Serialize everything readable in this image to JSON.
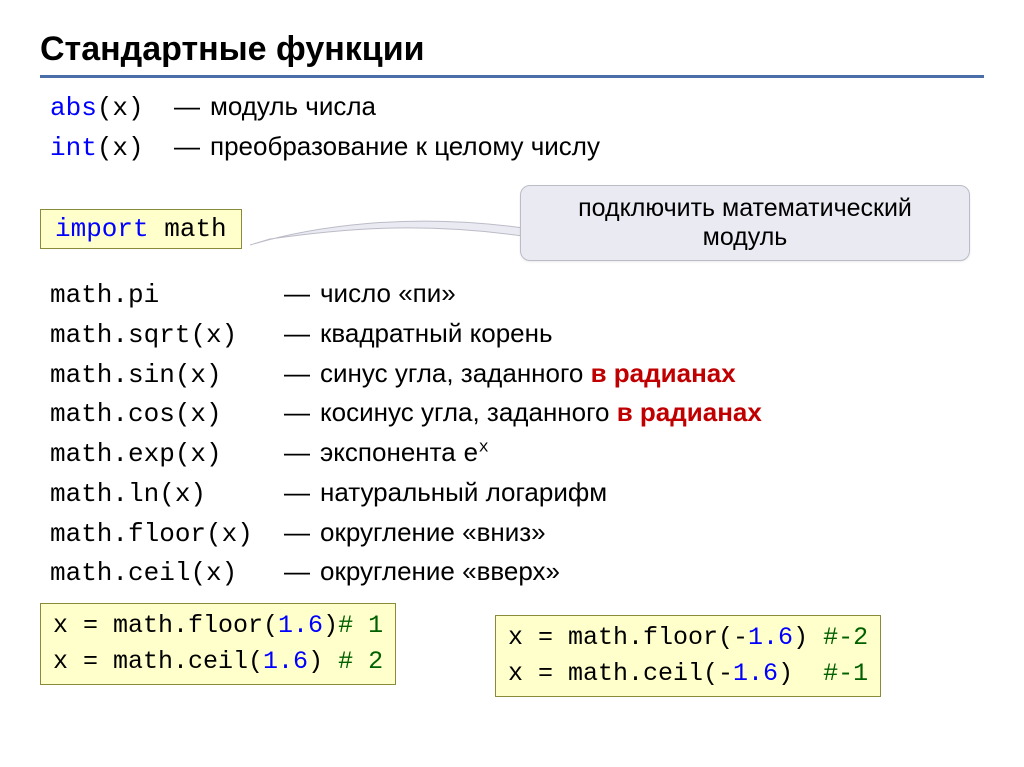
{
  "title": "Стандартные функции",
  "basic": {
    "abs_fn": "abs",
    "abs_args": "(x)",
    "abs_desc": "модуль числа",
    "int_fn": "int",
    "int_args": "(x)",
    "int_desc": "преобразование к целому числу"
  },
  "import_box": {
    "kw": "import",
    "mod": "math"
  },
  "callout": "подключить математический модуль",
  "math": {
    "pi_code": "math.pi",
    "pi_desc": "число «пи»",
    "sqrt_code": "math.sqrt",
    "sqrt_args": "(x)",
    "sqrt_desc": "квадратный корень",
    "sin_code": "math.sin",
    "sin_args": "(x)",
    "sin_desc": "синус угла, заданного ",
    "sin_red": "в радианах",
    "cos_code": "math.cos",
    "cos_args": "(x)",
    "cos_desc": "косинус угла, заданного ",
    "cos_red": "в радианах",
    "exp_code": "math.exp",
    "exp_args": "(x)",
    "exp_desc_a": "экспонента ",
    "exp_e": "e",
    "exp_sup": "x",
    "ln_code": "math.ln",
    "ln_args": "(x)",
    "ln_desc": "натуральный логарифм",
    "floor_code": "math.floor",
    "floor_args": "(x)",
    "floor_desc": "округление «вниз»",
    "ceil_code": "math.ceil",
    "ceil_args": "(x)",
    "ceil_desc": "округление «вверх»"
  },
  "dash": "—",
  "examples": {
    "left": {
      "l1_a": "x = math.floor(",
      "l1_num": "1.6",
      "l1_b": ")",
      "l1_c": "# 1",
      "l2_a": "x = math.ceil(",
      "l2_num": "1.6",
      "l2_b": ") ",
      "l2_c": "# 2"
    },
    "right": {
      "r1_a": "x = math.floor(-",
      "r1_num": "1.6",
      "r1_b": ") ",
      "r1_c": "#-2",
      "r2_a": "x = math.ceil(-",
      "r2_num": "1.6",
      "r2_b": ")  ",
      "r2_c": "#-1"
    }
  }
}
